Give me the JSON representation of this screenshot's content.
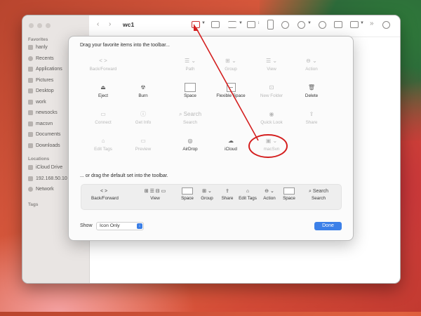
{
  "window": {
    "title": "wc1"
  },
  "sidebar": {
    "favorites_header": "Favorites",
    "favorites": [
      {
        "label": "hanly",
        "icon": "home-icon"
      },
      {
        "label": "Recents",
        "icon": "clock-icon"
      },
      {
        "label": "Applications",
        "icon": "applications-icon"
      },
      {
        "label": "Pictures",
        "icon": "pictures-icon"
      },
      {
        "label": "Desktop",
        "icon": "desktop-icon"
      },
      {
        "label": "work",
        "icon": "folder-icon"
      },
      {
        "label": "newsocks",
        "icon": "folder-icon"
      },
      {
        "label": "macsvn",
        "icon": "folder-icon"
      },
      {
        "label": "Documents",
        "icon": "documents-icon"
      },
      {
        "label": "Downloads",
        "icon": "downloads-icon"
      }
    ],
    "locations_header": "Locations",
    "locations": [
      {
        "label": "iCloud Drive",
        "icon": "cloud-icon"
      },
      {
        "label": "192.168.50.10",
        "icon": "server-icon"
      },
      {
        "label": "Network",
        "icon": "network-icon"
      }
    ],
    "tags_header": "Tags"
  },
  "sheet": {
    "heading": "Drag your favorite items into the toolbar...",
    "subheading": "... or drag the default set into the toolbar.",
    "palette": [
      {
        "label": "Back/Forward",
        "glyph": "<   >",
        "icon": "back-forward-icon",
        "dim": true
      },
      {
        "label": "Path",
        "glyph": "☰ ⌄",
        "icon": "path-icon",
        "dim": true
      },
      {
        "label": "Group",
        "glyph": "⊞ ⌄",
        "icon": "group-icon",
        "dim": true
      },
      {
        "label": "View",
        "glyph": "☰ ⌄",
        "icon": "view-icon",
        "dim": true
      },
      {
        "label": "Action",
        "glyph": "⊖ ⌄",
        "icon": "action-icon",
        "dim": true
      },
      {
        "label": "Eject",
        "glyph": "⏏",
        "icon": "eject-icon",
        "dim": false
      },
      {
        "label": "Burn",
        "glyph": "☢",
        "icon": "burn-icon",
        "dim": false
      },
      {
        "label": "Space",
        "glyph": "",
        "icon": "space-icon",
        "dim": false
      },
      {
        "label": "Flexible Space",
        "glyph": "",
        "icon": "flexible-space-icon",
        "dim": false
      },
      {
        "label": "New Folder",
        "glyph": "⊡",
        "icon": "new-folder-icon",
        "dim": true
      },
      {
        "label": "Delete",
        "glyph": "🗑",
        "icon": "trash-icon",
        "dim": false
      },
      {
        "label": "Connect",
        "glyph": "▭",
        "icon": "connect-icon",
        "dim": true
      },
      {
        "label": "Get Info",
        "glyph": "ⓘ",
        "icon": "info-icon",
        "dim": true
      },
      {
        "label": "Search",
        "glyph": "⌕ Search",
        "icon": "search-icon",
        "dim": true
      },
      {
        "label": "Quick Look",
        "glyph": "◉",
        "icon": "eye-icon",
        "dim": true
      },
      {
        "label": "Share",
        "glyph": "⇪",
        "icon": "share-icon",
        "dim": true
      },
      {
        "label": "Edit Tags",
        "glyph": "⌂",
        "icon": "tag-icon",
        "dim": true
      },
      {
        "label": "Preview",
        "glyph": "▭",
        "icon": "preview-icon",
        "dim": true
      },
      {
        "label": "AirDrop",
        "glyph": "◎",
        "icon": "airdrop-icon",
        "dim": false
      },
      {
        "label": "iCloud",
        "glyph": "☁",
        "icon": "icloud-icon",
        "dim": false
      },
      {
        "label": "macSvn",
        "glyph": "▣ ⌄",
        "icon": "macsvn-icon",
        "dim": true
      }
    ],
    "default_set": [
      {
        "label": "Back/Forward",
        "glyph": "<   >"
      },
      {
        "label": "View",
        "glyph": "⊞ ☰ ⊟ ▭"
      },
      {
        "label": "Space",
        "glyph": ""
      },
      {
        "label": "Group",
        "glyph": "⊞ ⌄"
      },
      {
        "label": "Share",
        "glyph": "⇪"
      },
      {
        "label": "Edit Tags",
        "glyph": "⌂"
      },
      {
        "label": "Action",
        "glyph": "⊖ ⌄"
      },
      {
        "label": "Space",
        "glyph": ""
      },
      {
        "label": "Search",
        "glyph": "⌕ Search"
      }
    ],
    "show_label": "Show",
    "show_value": "Icon Only",
    "done_label": "Done"
  },
  "colors": {
    "accent": "#3c80e8",
    "annotation": "#d41f1f"
  }
}
